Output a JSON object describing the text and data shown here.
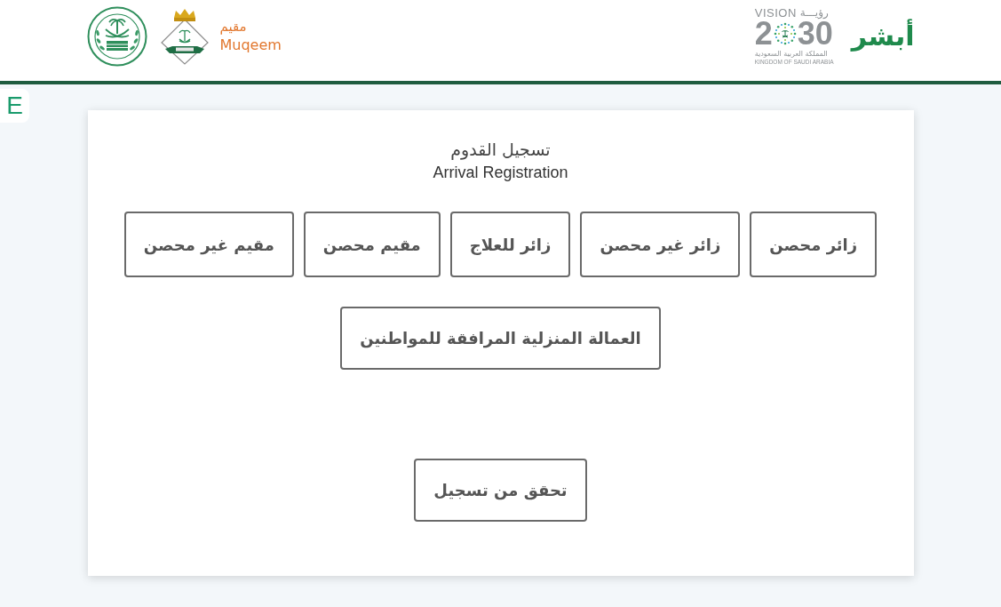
{
  "header": {
    "muqeem_logo": {
      "name_ar": "مقيم",
      "name_en": "Muqeem"
    },
    "vision_logo": {
      "word_en": "VISION",
      "word_ar": "رؤيـــة",
      "year_start": "2",
      "year_end": "30",
      "country_ar": "المملكة العربية السعودية",
      "country_en": "KINGDOM OF SAUDI ARABIA"
    },
    "absher_logo": {
      "text": "أبشر"
    }
  },
  "language_toggle": {
    "label": "E"
  },
  "card": {
    "title_ar": "تسجيل القدوم",
    "title_en": "Arrival Registration",
    "button_rows": [
      {
        "buttons": [
          "زائر محصن",
          "زائر غير محصن",
          "زائر للعلاج",
          "مقيم محصن",
          "مقيم غير محصن"
        ]
      },
      {
        "buttons": [
          "العمالة المنزلية المرافقة للمواطنين"
        ]
      },
      {
        "buttons": [
          "تحقق من تسجيل"
        ]
      }
    ]
  }
}
